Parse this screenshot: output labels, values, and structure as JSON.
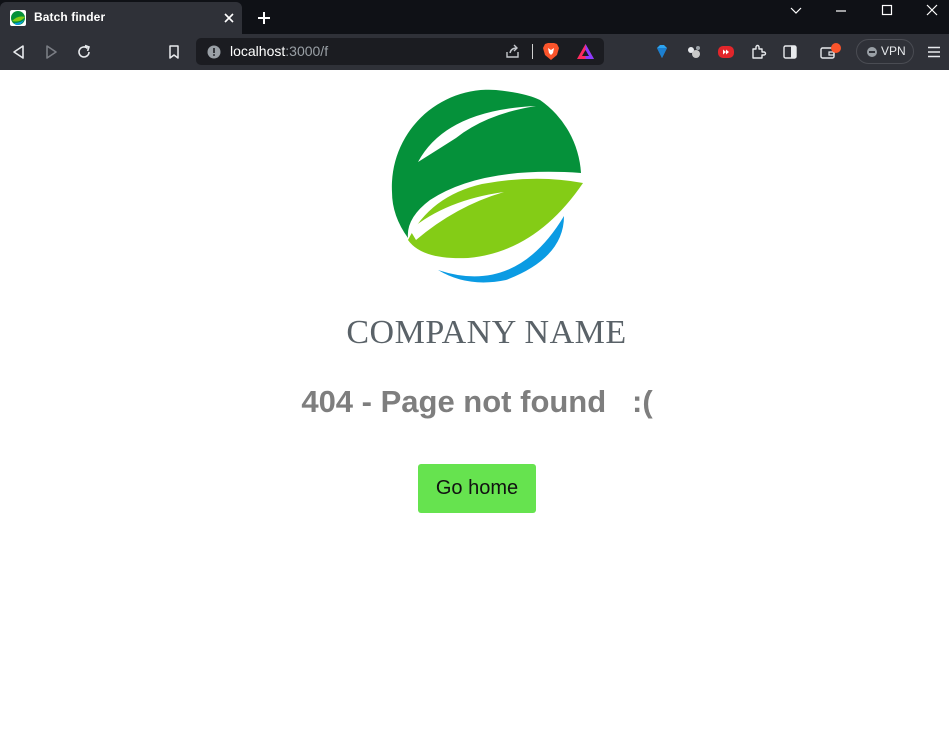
{
  "browser": {
    "tab_title": "Batch finder",
    "url_host": "localhost",
    "url_path": ":3000/f",
    "vpn_label": "VPN",
    "icons": [
      "back-icon",
      "forward-icon",
      "reload-icon",
      "bookmark-icon",
      "site-info-icon",
      "share-icon",
      "brave-shields-icon",
      "brave-rewards-icon",
      "extension-icon",
      "extensions-puzzle-icon",
      "sidebar-icon",
      "wallet-icon",
      "menu-icon"
    ]
  },
  "page": {
    "company_name": "COMPANY NAME",
    "error_message": "404 - Page not found   :(",
    "go_home_label": "Go home"
  },
  "colors": {
    "button_bg": "#66e34f",
    "logo_dark_green": "#05913a",
    "logo_light_green": "#84cc16",
    "logo_blue": "#0b9be3"
  }
}
